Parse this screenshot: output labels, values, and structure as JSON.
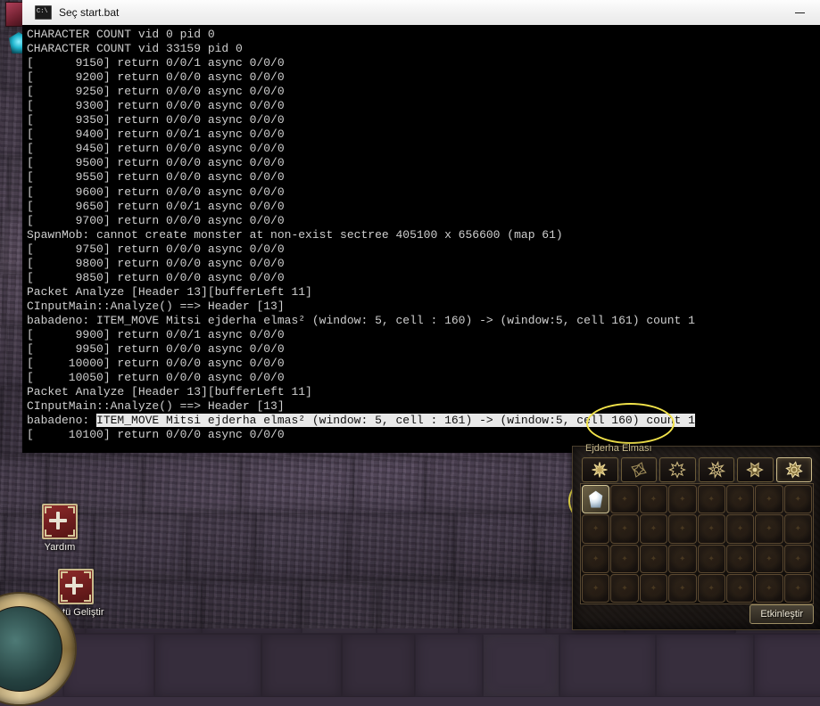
{
  "window": {
    "title": "Seç start.bat",
    "icon": "console-icon",
    "minimize_label": "—"
  },
  "console": {
    "lines": [
      {
        "text": "CHARACTER COUNT vid 0 pid 0"
      },
      {
        "text": "CHARACTER COUNT vid 33159 pid 0"
      },
      {
        "text": "[      9150] return 0/0/1 async 0/0/0"
      },
      {
        "text": "[      9200] return 0/0/0 async 0/0/0"
      },
      {
        "text": "[      9250] return 0/0/0 async 0/0/0"
      },
      {
        "text": "[      9300] return 0/0/0 async 0/0/0"
      },
      {
        "text": "[      9350] return 0/0/0 async 0/0/0"
      },
      {
        "text": "[      9400] return 0/0/1 async 0/0/0"
      },
      {
        "text": "[      9450] return 0/0/0 async 0/0/0"
      },
      {
        "text": "[      9500] return 0/0/0 async 0/0/0"
      },
      {
        "text": "[      9550] return 0/0/0 async 0/0/0"
      },
      {
        "text": "[      9600] return 0/0/0 async 0/0/0"
      },
      {
        "text": "[      9650] return 0/0/1 async 0/0/0"
      },
      {
        "text": "[      9700] return 0/0/0 async 0/0/0"
      },
      {
        "text": "SpawnMob: cannot create monster at non-exist sectree 405100 x 656600 (map 61)"
      },
      {
        "text": "[      9750] return 0/0/0 async 0/0/0"
      },
      {
        "text": "[      9800] return 0/0/0 async 0/0/0"
      },
      {
        "text": "[      9850] return 0/0/0 async 0/0/0"
      },
      {
        "text": "Packet Analyze [Header 13][bufferLeft 11]"
      },
      {
        "text": "CInputMain::Analyze() ==> Header [13]"
      },
      {
        "text": "babadeno: ITEM_MOVE Mitsi ejderha elmas² (window: 5, cell : 160) -> (window:5, cell 161) count 1"
      },
      {
        "text": "[      9900] return 0/0/1 async 0/0/0"
      },
      {
        "text": "[      9950] return 0/0/0 async 0/0/0"
      },
      {
        "text": "[     10000] return 0/0/0 async 0/0/0"
      },
      {
        "text": "[     10050] return 0/0/0 async 0/0/0"
      },
      {
        "text": "Packet Analyze [Header 13][bufferLeft 11]"
      },
      {
        "text": "CInputMain::Analyze() ==> Header [13]"
      },
      {
        "prefix": "babadeno: ",
        "selected": "ITEM_MOVE Mitsi ejderha elmas² (window: 5, cell : 161) -> (window:5, cell 160) count 1"
      },
      {
        "text": "[     10100] return 0/0/0 async 0/0/0"
      }
    ]
  },
  "desktop": {
    "icons": [
      {
        "label": "Yardım",
        "icon": "red-cross-icon"
      },
      {
        "label": "Statü Geliştir",
        "icon": "red-cross-icon"
      }
    ]
  },
  "inventory": {
    "title": "Ejderha Elması",
    "tabs": [
      {
        "icon": "sun-burst-icon",
        "active": false
      },
      {
        "icon": "star-outline-icon",
        "active": false
      },
      {
        "icon": "star-burst-icon",
        "active": false
      },
      {
        "icon": "flower-star-icon",
        "active": false
      },
      {
        "icon": "rosette-icon",
        "active": false
      },
      {
        "icon": "gear-rosette-icon",
        "active": true
      }
    ],
    "columns": 8,
    "rows": 4,
    "cells": [
      {
        "index": 0,
        "item": "ejderha-elmasi",
        "icon": "diamond-gem-icon"
      },
      {
        "index": 1,
        "item": null
      },
      {
        "index": 2,
        "item": null
      },
      {
        "index": 3,
        "item": null
      },
      {
        "index": 4,
        "item": null
      },
      {
        "index": 5,
        "item": null
      },
      {
        "index": 6,
        "item": null
      },
      {
        "index": 7,
        "item": null
      },
      {
        "index": 8,
        "item": null
      },
      {
        "index": 9,
        "item": null
      },
      {
        "index": 10,
        "item": null
      },
      {
        "index": 11,
        "item": null
      },
      {
        "index": 12,
        "item": null
      },
      {
        "index": 13,
        "item": null
      },
      {
        "index": 14,
        "item": null
      },
      {
        "index": 15,
        "item": null
      },
      {
        "index": 16,
        "item": null
      },
      {
        "index": 17,
        "item": null
      },
      {
        "index": 18,
        "item": null
      },
      {
        "index": 19,
        "item": null
      },
      {
        "index": 20,
        "item": null
      },
      {
        "index": 21,
        "item": null
      },
      {
        "index": 22,
        "item": null
      },
      {
        "index": 23,
        "item": null
      },
      {
        "index": 24,
        "item": null
      },
      {
        "index": 25,
        "item": null
      },
      {
        "index": 26,
        "item": null
      },
      {
        "index": 27,
        "item": null
      },
      {
        "index": 28,
        "item": null
      },
      {
        "index": 29,
        "item": null
      },
      {
        "index": 30,
        "item": null
      },
      {
        "index": 31,
        "item": null
      }
    ],
    "activate_label": "Etkinleştir"
  },
  "annotations": [
    {
      "name": "cell-160-highlight",
      "shape": "ellipse",
      "color": "#f2e34a"
    },
    {
      "name": "inventory-item-highlight",
      "shape": "ellipse",
      "color": "#f2e34a"
    }
  ],
  "colors": {
    "console_bg": "#000000",
    "console_text": "#cfcfcf",
    "selection_bg": "#e9e9e9",
    "selection_text": "#101010",
    "annotation": "#f2e34a",
    "titlebar_bg": "#f4f4f4"
  }
}
